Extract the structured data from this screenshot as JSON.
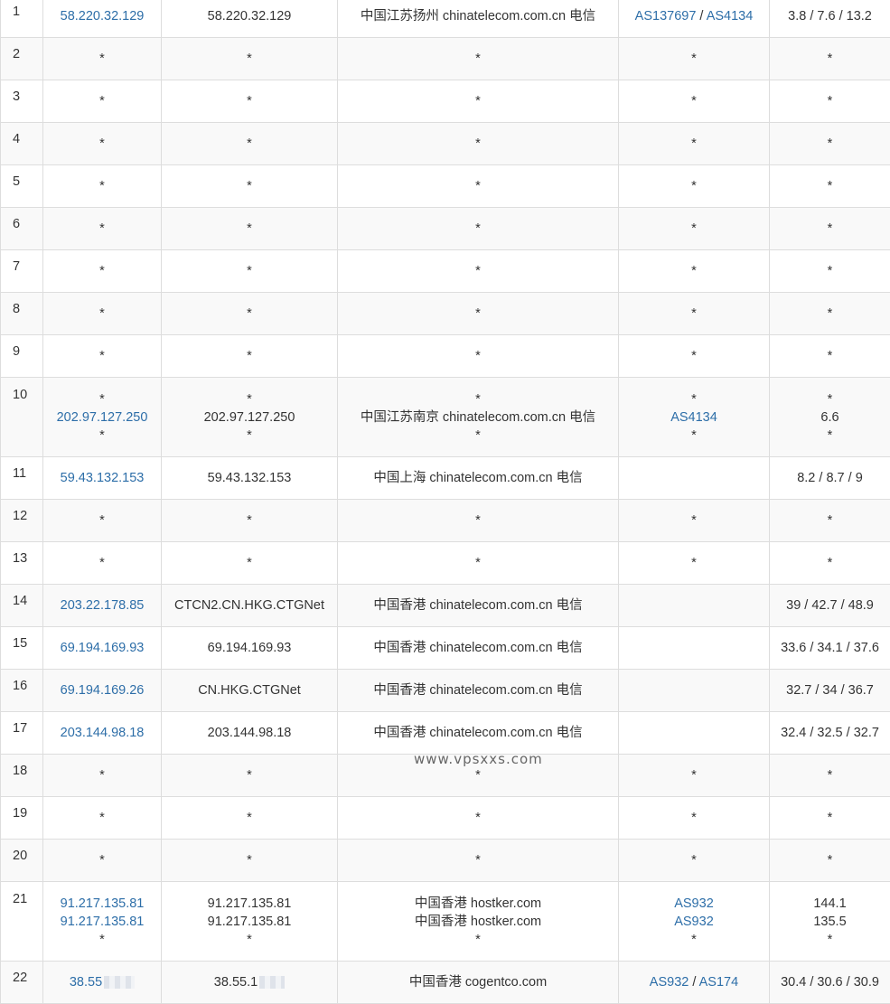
{
  "rows": [
    {
      "hop": "1",
      "lines": [
        {
          "ip": "58.220.32.129",
          "host": "58.220.32.129",
          "location": "中国江苏扬州 chinatelecom.com.cn 电信",
          "asn": [
            "AS137697",
            "AS4134"
          ],
          "rtt": "3.8 / 7.6 / 13.2"
        }
      ]
    },
    {
      "hop": "2",
      "lines": [
        {
          "ip": "*",
          "host": "*",
          "location": "*",
          "asn": [
            "*"
          ],
          "rtt": "*"
        }
      ]
    },
    {
      "hop": "3",
      "lines": [
        {
          "ip": "*",
          "host": "*",
          "location": "*",
          "asn": [
            "*"
          ],
          "rtt": "*"
        }
      ]
    },
    {
      "hop": "4",
      "lines": [
        {
          "ip": "*",
          "host": "*",
          "location": "*",
          "asn": [
            "*"
          ],
          "rtt": "*"
        }
      ]
    },
    {
      "hop": "5",
      "lines": [
        {
          "ip": "*",
          "host": "*",
          "location": "*",
          "asn": [
            "*"
          ],
          "rtt": "*"
        }
      ]
    },
    {
      "hop": "6",
      "lines": [
        {
          "ip": "*",
          "host": "*",
          "location": "*",
          "asn": [
            "*"
          ],
          "rtt": "*"
        }
      ]
    },
    {
      "hop": "7",
      "lines": [
        {
          "ip": "*",
          "host": "*",
          "location": "*",
          "asn": [
            "*"
          ],
          "rtt": "*"
        }
      ]
    },
    {
      "hop": "8",
      "lines": [
        {
          "ip": "*",
          "host": "*",
          "location": "*",
          "asn": [
            "*"
          ],
          "rtt": "*"
        }
      ]
    },
    {
      "hop": "9",
      "lines": [
        {
          "ip": "*",
          "host": "*",
          "location": "*",
          "asn": [
            "*"
          ],
          "rtt": "*"
        }
      ]
    },
    {
      "hop": "10",
      "lines": [
        {
          "ip": "*",
          "host": "*",
          "location": "*",
          "asn": [
            "*"
          ],
          "rtt": "*"
        },
        {
          "ip": "202.97.127.250",
          "host": "202.97.127.250",
          "location": "中国江苏南京 chinatelecom.com.cn 电信",
          "asn": [
            "AS4134"
          ],
          "rtt": "6.6"
        },
        {
          "ip": "*",
          "host": "*",
          "location": "*",
          "asn": [
            "*"
          ],
          "rtt": "*"
        }
      ]
    },
    {
      "hop": "11",
      "lines": [
        {
          "ip": "59.43.132.153",
          "host": "59.43.132.153",
          "location": "中国上海 chinatelecom.com.cn 电信",
          "asn": [],
          "rtt": "8.2 / 8.7 / 9"
        }
      ]
    },
    {
      "hop": "12",
      "lines": [
        {
          "ip": "*",
          "host": "*",
          "location": "*",
          "asn": [
            "*"
          ],
          "rtt": "*"
        }
      ]
    },
    {
      "hop": "13",
      "lines": [
        {
          "ip": "*",
          "host": "*",
          "location": "*",
          "asn": [
            "*"
          ],
          "rtt": "*"
        }
      ]
    },
    {
      "hop": "14",
      "lines": [
        {
          "ip": "203.22.178.85",
          "host": "CTCN2.CN.HKG.CTGNet",
          "location": "中国香港 chinatelecom.com.cn 电信",
          "asn": [],
          "rtt": "39 / 42.7 / 48.9"
        }
      ]
    },
    {
      "hop": "15",
      "lines": [
        {
          "ip": "69.194.169.93",
          "host": "69.194.169.93",
          "location": "中国香港 chinatelecom.com.cn 电信",
          "asn": [],
          "rtt": "33.6 / 34.1 / 37.6"
        }
      ]
    },
    {
      "hop": "16",
      "lines": [
        {
          "ip": "69.194.169.26",
          "host": "CN.HKG.CTGNet",
          "location": "中国香港 chinatelecom.com.cn 电信",
          "asn": [],
          "rtt": "32.7 / 34 / 36.7"
        }
      ]
    },
    {
      "hop": "17",
      "lines": [
        {
          "ip": "203.144.98.18",
          "host": "203.144.98.18",
          "location": "中国香港 chinatelecom.com.cn 电信",
          "asn": [],
          "rtt": "32.4 / 32.5 / 32.7"
        }
      ]
    },
    {
      "hop": "18",
      "lines": [
        {
          "ip": "*",
          "host": "*",
          "location": "*",
          "asn": [
            "*"
          ],
          "rtt": "*"
        }
      ]
    },
    {
      "hop": "19",
      "lines": [
        {
          "ip": "*",
          "host": "*",
          "location": "*",
          "asn": [
            "*"
          ],
          "rtt": "*"
        }
      ]
    },
    {
      "hop": "20",
      "lines": [
        {
          "ip": "*",
          "host": "*",
          "location": "*",
          "asn": [
            "*"
          ],
          "rtt": "*"
        }
      ]
    },
    {
      "hop": "21",
      "lines": [
        {
          "ip": "91.217.135.81",
          "host": "91.217.135.81",
          "location": "中国香港 hostker.com",
          "asn": [
            "AS932"
          ],
          "rtt": "144.1"
        },
        {
          "ip": "91.217.135.81",
          "host": "91.217.135.81",
          "location": "中国香港 hostker.com",
          "asn": [
            "AS932"
          ],
          "rtt": "135.5"
        },
        {
          "ip": "*",
          "host": "*",
          "location": "*",
          "asn": [
            "*"
          ],
          "rtt": "*"
        }
      ]
    },
    {
      "hop": "22",
      "lines": [
        {
          "ip": "38.55",
          "ipBlur": true,
          "host": "38.55.1",
          "hostBlur": true,
          "location": "中国香港 cogentco.com",
          "asn": [
            "AS932",
            "AS174"
          ],
          "rtt": "30.4 / 30.6 / 30.9"
        }
      ]
    }
  ],
  "watermark": "www.vpsxxs.com"
}
